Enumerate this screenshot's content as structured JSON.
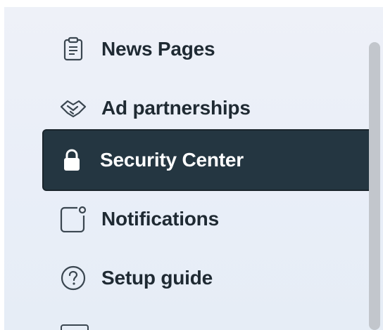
{
  "sidebar": {
    "items": [
      {
        "label": "News Pages",
        "icon": "clipboard-icon",
        "active": false
      },
      {
        "label": "Ad partnerships",
        "icon": "handshake-icon",
        "active": false
      },
      {
        "label": "Security Center",
        "icon": "lock-icon",
        "active": true
      },
      {
        "label": "Notifications",
        "icon": "notification-square-icon",
        "active": false
      },
      {
        "label": "Setup guide",
        "icon": "question-circle-icon",
        "active": false
      }
    ]
  },
  "colors": {
    "sidebar_bg": "#eef1f8",
    "active_bg": "#243641",
    "text": "#1f2a33",
    "active_text": "#ffffff",
    "scrollbar": "#c2c6cc"
  }
}
